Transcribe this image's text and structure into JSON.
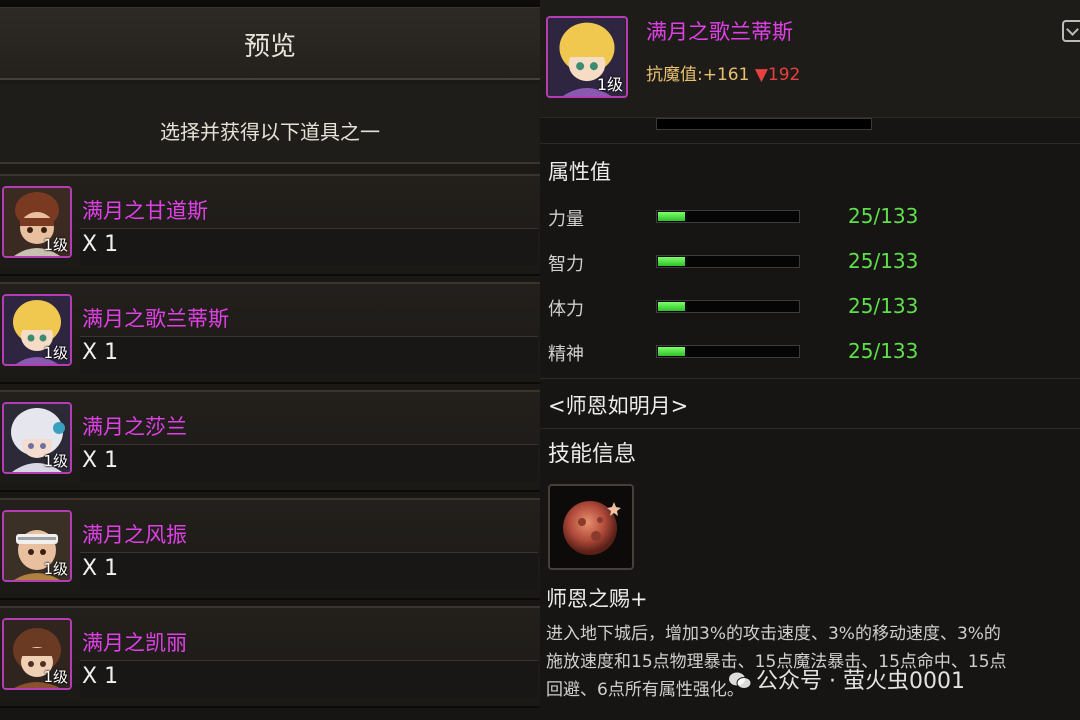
{
  "preview": {
    "title": "预览",
    "instruction": "选择并获得以下道具之一",
    "items": [
      {
        "name": "满月之甘道斯",
        "level": "1级",
        "quantity": "X 1",
        "portrait": "brown-haired-warrior"
      },
      {
        "name": "满月之歌兰蒂斯",
        "level": "1级",
        "quantity": "X 1",
        "portrait": "blonde-girl"
      },
      {
        "name": "满月之莎兰",
        "level": "1级",
        "quantity": "X 1",
        "portrait": "white-haired-mage"
      },
      {
        "name": "满月之风振",
        "level": "1级",
        "quantity": "X 1",
        "portrait": "bandana-fighter"
      },
      {
        "name": "满月之凯丽",
        "level": "1级",
        "quantity": "X 1",
        "portrait": "gunner-girl"
      }
    ]
  },
  "detail": {
    "name": "满月之歌兰蒂斯",
    "level": "1级",
    "resist_label": "抗魔值:",
    "resist_gain": "+161",
    "resist_loss": "192",
    "attributes_title": "属性值",
    "stats": [
      {
        "label": "力量",
        "value": "25/133",
        "ratio": 0.19
      },
      {
        "label": "智力",
        "value": "25/133",
        "ratio": 0.19
      },
      {
        "label": "体力",
        "value": "25/133",
        "ratio": 0.19
      },
      {
        "label": "精神",
        "value": "25/133",
        "ratio": 0.19
      }
    ],
    "quote": "<师恩如明月>",
    "skill_section_title": "技能信息",
    "skill_name": "师恩之赐+",
    "skill_description": "进入地下城后，增加3%的攻击速度、3%的移动速度、3%的\n施放速度和15点物理暴击、15点魔法暴击、15点命中、15点\n回避、6点所有属性强化。"
  },
  "watermark": "公众号 · 萤火虫0001",
  "colors": {
    "name_accent": "#e040e6",
    "stat_value": "#5fe04a",
    "resist_down": "#e84040"
  }
}
